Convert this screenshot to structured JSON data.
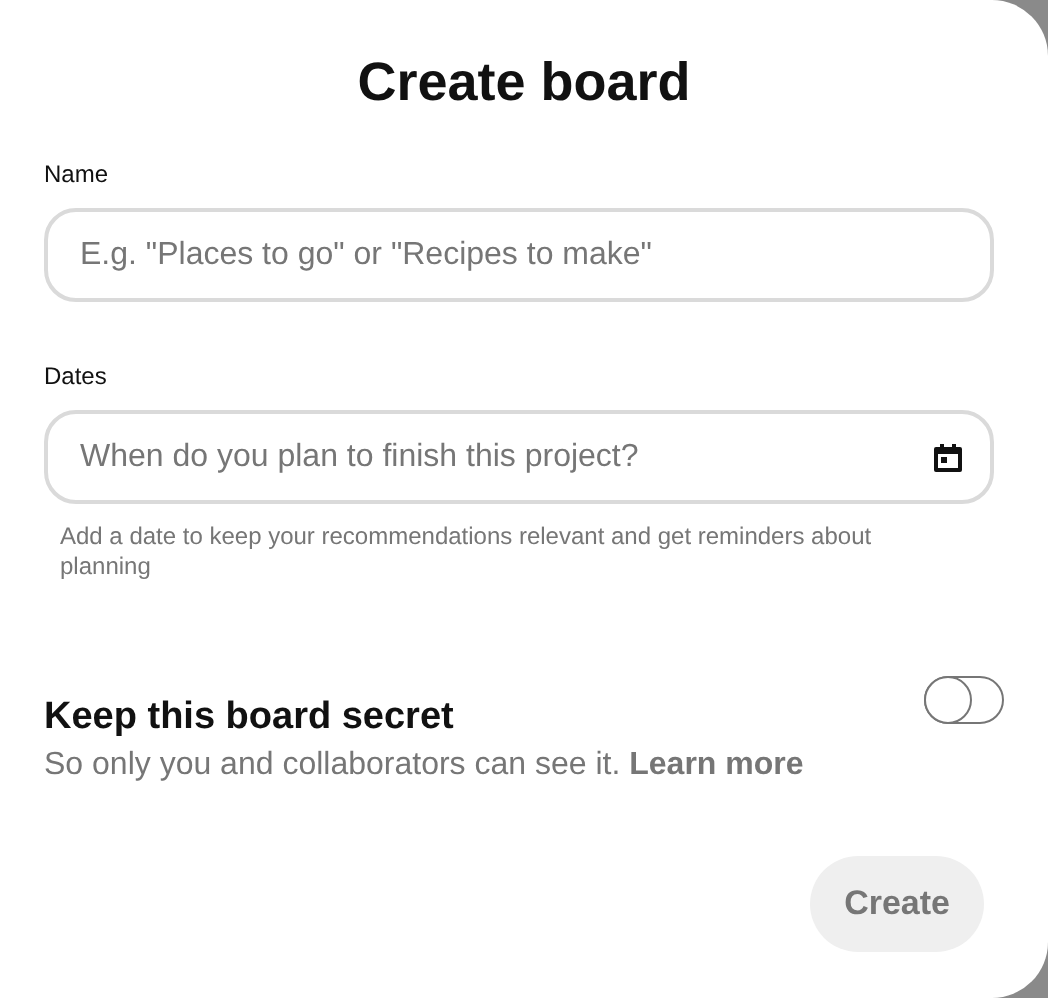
{
  "dialog": {
    "title": "Create board"
  },
  "fields": [
    {
      "kind": "text",
      "label": "Name",
      "placeholder": "E.g. \"Places to go\" or \"Recipes to make\""
    },
    {
      "kind": "date",
      "label": "Dates",
      "placeholder": "When do you plan to finish this project?",
      "hint": "Add a date to keep your recommendations relevant and get reminders about planning"
    }
  ],
  "secret": {
    "title": "Keep this board secret",
    "description": "So only you and collaborators can see it.",
    "link": "Learn more",
    "on": false
  },
  "create_button": {
    "label": "Create",
    "disabled": true
  }
}
